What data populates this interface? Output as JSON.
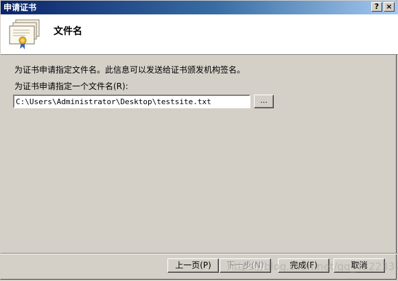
{
  "window": {
    "title": "申请证书",
    "help_label": "?",
    "close_label": "×"
  },
  "header": {
    "title": "文件名",
    "icon": "certificate-icon"
  },
  "content": {
    "description": "为证书申请指定文件名。此信息可以发送给证书颁发机构签名。",
    "field_label": "为证书申请指定一个文件名(R):",
    "file_path": "C:\\Users\\Administrator\\Desktop\\testsite.txt",
    "browse_label": "..."
  },
  "footer": {
    "back_label": "上一页(P)",
    "next_label": "下一步(N)",
    "finish_label": "完成(F)",
    "cancel_label": "取消"
  },
  "watermark": "https://blog.csdn.net/qq_43223320"
}
